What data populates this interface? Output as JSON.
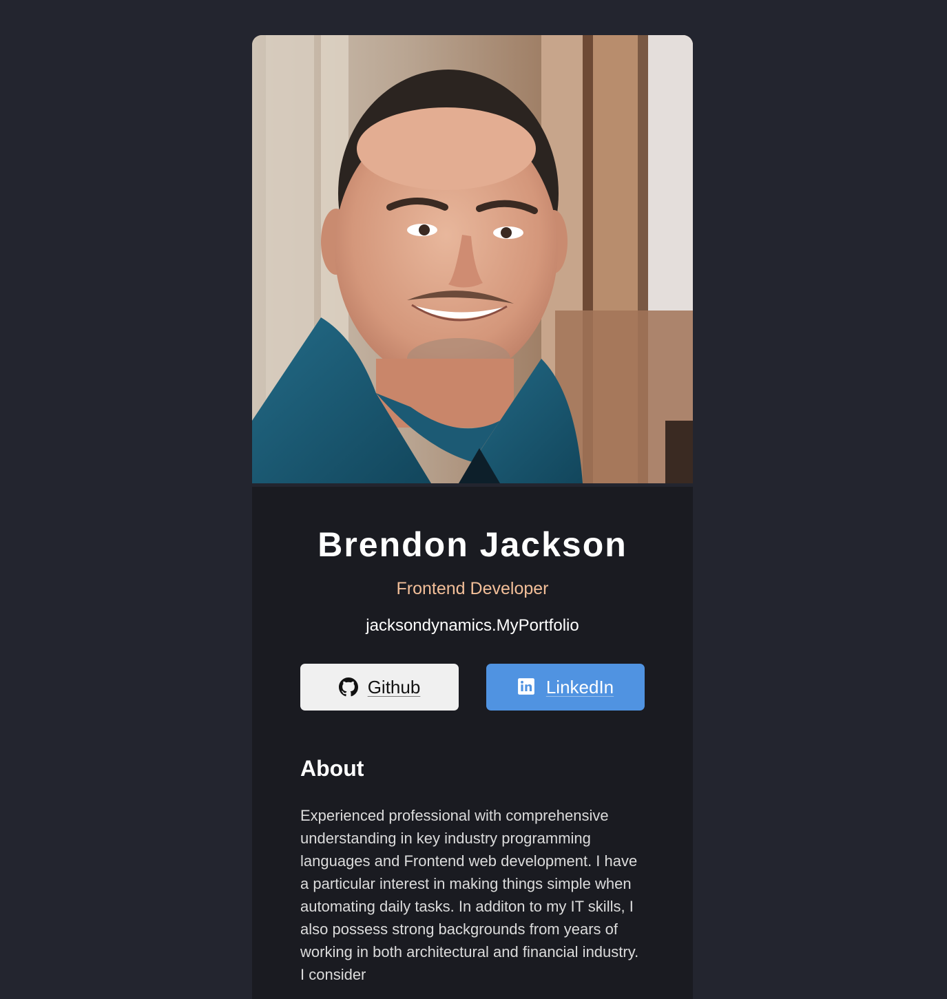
{
  "profile": {
    "name": "Brendon Jackson",
    "role": "Frontend Developer",
    "site": "jacksondynamics.MyPortfolio",
    "photo_alt": "Portrait of Brendon Jackson"
  },
  "buttons": {
    "github": {
      "label": "Github",
      "icon": "github-icon"
    },
    "linkedin": {
      "label": "LinkedIn",
      "icon": "linkedin-icon"
    }
  },
  "about": {
    "heading": "About",
    "text": "Experienced professional with comprehensive understanding in key industry programming languages and Frontend web development. I have a particular interest in making things simple when automating daily tasks. In additon to my IT skills, I also possess strong backgrounds from years of working in both architectural and financial industry. I consider"
  },
  "colors": {
    "page_bg": "#23252f",
    "card_bg": "#1a1b21",
    "role_accent": "#f3bf99",
    "github_button": "#f0f0f0",
    "linkedin_button": "#5093e1"
  }
}
